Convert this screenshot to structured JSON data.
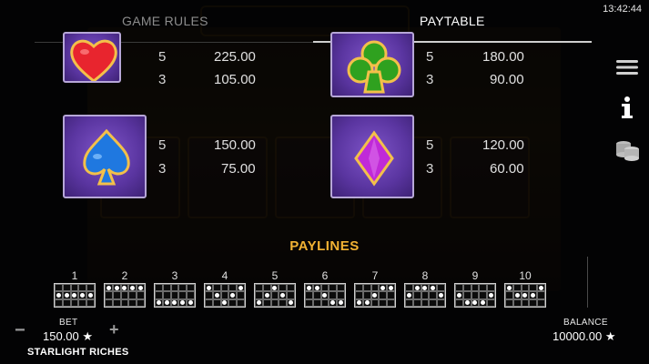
{
  "header": {
    "clock": "13:42:44",
    "tabs": [
      {
        "label": "GAME RULES",
        "active": false
      },
      {
        "label": "PAYTABLE",
        "active": true
      }
    ]
  },
  "paytable": [
    {
      "symbol": "heart-icon",
      "color": "#e8252e",
      "pays": [
        {
          "count": "5",
          "amount": "225.00"
        },
        {
          "count": "3",
          "amount": "105.00"
        }
      ]
    },
    {
      "symbol": "club-icon",
      "color": "#2fa11f",
      "pays": [
        {
          "count": "5",
          "amount": "180.00"
        },
        {
          "count": "3",
          "amount": "90.00"
        }
      ]
    },
    {
      "symbol": "spade-icon",
      "color": "#1f78e0",
      "pays": [
        {
          "count": "5",
          "amount": "150.00"
        },
        {
          "count": "3",
          "amount": "75.00"
        }
      ]
    },
    {
      "symbol": "diamond-icon",
      "color": "#c02ad8",
      "pays": [
        {
          "count": "5",
          "amount": "120.00"
        },
        {
          "count": "3",
          "amount": "60.00"
        }
      ]
    }
  ],
  "paylines": {
    "title": "PAYLINES",
    "lines": [
      {
        "number": "1",
        "rows": [
          1,
          1,
          1,
          1,
          1
        ]
      },
      {
        "number": "2",
        "rows": [
          0,
          0,
          0,
          0,
          0
        ]
      },
      {
        "number": "3",
        "rows": [
          2,
          2,
          2,
          2,
          2
        ]
      },
      {
        "number": "4",
        "rows": [
          0,
          1,
          2,
          1,
          0
        ]
      },
      {
        "number": "5",
        "rows": [
          2,
          1,
          0,
          1,
          2
        ]
      },
      {
        "number": "6",
        "rows": [
          0,
          0,
          1,
          2,
          2
        ]
      },
      {
        "number": "7",
        "rows": [
          2,
          2,
          1,
          0,
          0
        ]
      },
      {
        "number": "8",
        "rows": [
          1,
          0,
          0,
          0,
          1
        ]
      },
      {
        "number": "9",
        "rows": [
          1,
          2,
          2,
          2,
          1
        ]
      },
      {
        "number": "10",
        "rows": [
          0,
          1,
          1,
          1,
          0
        ]
      }
    ]
  },
  "sidebar": {
    "menu_icon": "hamburger-menu-icon",
    "info_icon": "info-icon",
    "coins_icon": "coin-stack-icon"
  },
  "footer": {
    "minus": "−",
    "plus": "+",
    "bet_label": "BET",
    "bet_value": "150.00 ★",
    "game_name": "STARLIGHT RICHES",
    "balance_label": "BALANCE",
    "balance_value": "10000.00 ★"
  }
}
